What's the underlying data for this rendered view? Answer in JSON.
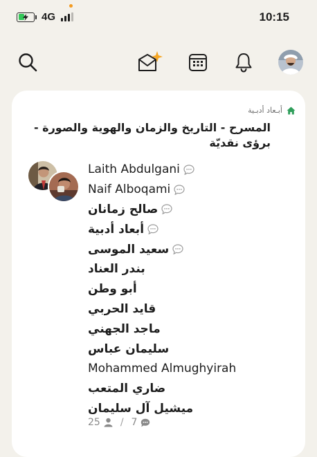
{
  "status_bar": {
    "time": "10:15",
    "network": "4G",
    "battery_level": 0.45
  },
  "nav": {
    "icons": [
      "search-icon",
      "inbox-sparkle-icon",
      "calendar-icon",
      "bell-icon",
      "profile-avatar"
    ]
  },
  "chat": {
    "group_name": "أبـعاد أدبـية",
    "title": "المسرح - التاريخ والزمان والهوية والصورة - برؤى نقديّة",
    "members": [
      {
        "name": "Laith Abdulgani",
        "latin": true,
        "bubble": true
      },
      {
        "name": "Naif Alboqami",
        "latin": true,
        "bubble": true
      },
      {
        "name": "صالح زمانان",
        "latin": false,
        "bubble": true
      },
      {
        "name": "أبعاد أدبية",
        "latin": false,
        "bubble": true
      },
      {
        "name": "سعيد الموسى",
        "latin": false,
        "bubble": true
      },
      {
        "name": "بندر العناد",
        "latin": false,
        "bubble": false
      },
      {
        "name": "أبو وطن",
        "latin": false,
        "bubble": false
      },
      {
        "name": "قايد الحربي",
        "latin": false,
        "bubble": false
      },
      {
        "name": "ماجد الجهني",
        "latin": false,
        "bubble": false
      },
      {
        "name": "سليمان عباس",
        "latin": false,
        "bubble": false
      },
      {
        "name": "Mohammed Almughyirah",
        "latin": true,
        "bubble": false
      },
      {
        "name": "ضاري المتعب",
        "latin": false,
        "bubble": false
      },
      {
        "name": "ميشيل آل سليمان",
        "latin": false,
        "bubble": false
      }
    ],
    "member_count": "25",
    "message_count": "7"
  }
}
